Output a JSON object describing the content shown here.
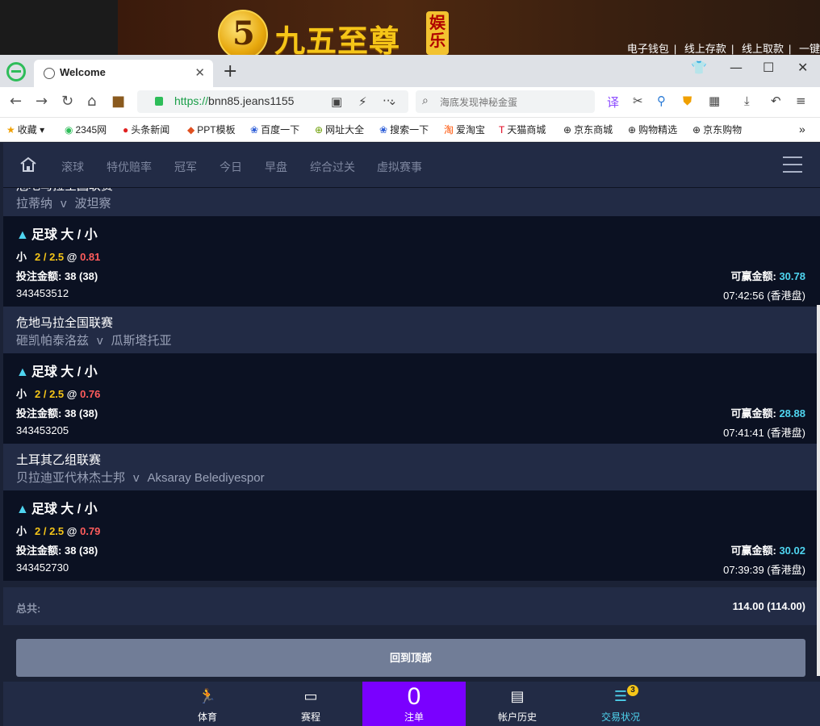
{
  "banner": {
    "logo_number": "5",
    "logo_text": "九五至尊",
    "logo_tag": "娱乐",
    "links": [
      "电子钱包",
      "线上存款",
      "线上取款",
      "一键"
    ]
  },
  "browser": {
    "tab_title": "Welcome",
    "url_scheme": "https://",
    "url_rest": "bnn85.jeans1155",
    "search_placeholder": "海底发现神秘金蛋",
    "bookmarks": [
      "收藏",
      "2345网",
      "头条新闻",
      "PPT模板",
      "百度一下",
      "网址大全",
      "搜索一下",
      "爱淘宝",
      "天猫商城",
      "京东商城",
      "购物精选",
      "京东购物"
    ]
  },
  "app": {
    "nav": [
      "滚球",
      "特优赔率",
      "冠军",
      "今日",
      "早盘",
      "综合过关",
      "虚拟赛事"
    ],
    "entries": [
      {
        "league": "危地马拉全国联赛",
        "home": "拉蒂纳",
        "away": "波坦察",
        "market": "足球 大 / 小",
        "pick": "小",
        "line": "2 / 2.5",
        "at": "@",
        "odds": "0.81",
        "stake_label": "投注金额:",
        "stake": "38 (38)",
        "win_label": "可赢金额:",
        "win": "30.78",
        "ref": "343453512",
        "time": "07:42:56 (香港盘)"
      },
      {
        "league": "危地马拉全国联赛",
        "home": "砸凯帕泰洛兹",
        "away": "瓜斯塔托亚",
        "market": "足球 大 / 小",
        "pick": "小",
        "line": "2 / 2.5",
        "at": "@",
        "odds": "0.76",
        "stake_label": "投注金额:",
        "stake": "38 (38)",
        "win_label": "可赢金额:",
        "win": "28.88",
        "ref": "343453205",
        "time": "07:41:41 (香港盘)"
      },
      {
        "league": "土耳其乙组联赛",
        "home": "贝拉迪亚代林杰士邦",
        "away": "Aksaray Belediyespor",
        "market": "足球 大 / 小",
        "pick": "小",
        "line": "2 / 2.5",
        "at": "@",
        "odds": "0.79",
        "stake_label": "投注金额:",
        "stake": "38 (38)",
        "win_label": "可赢金额:",
        "win": "30.02",
        "ref": "343452730",
        "time": "07:39:39 (香港盘)"
      }
    ],
    "vs": "v",
    "total_label": "总共:",
    "total_value": "114.00 (114.00)",
    "back_top": "回到顶部",
    "bottom_tabs": {
      "sports": "体育",
      "schedule": "赛程",
      "betslip_count": "0",
      "betslip": "注单",
      "history": "帐户历史",
      "trades": "交易状况",
      "trades_badge": "3"
    }
  },
  "colors": {
    "accent_purple": "#7a00ff",
    "accent_cyan": "#4fd5f0",
    "line_yellow": "#f5c518",
    "odds_red": "#ff5c5c"
  }
}
